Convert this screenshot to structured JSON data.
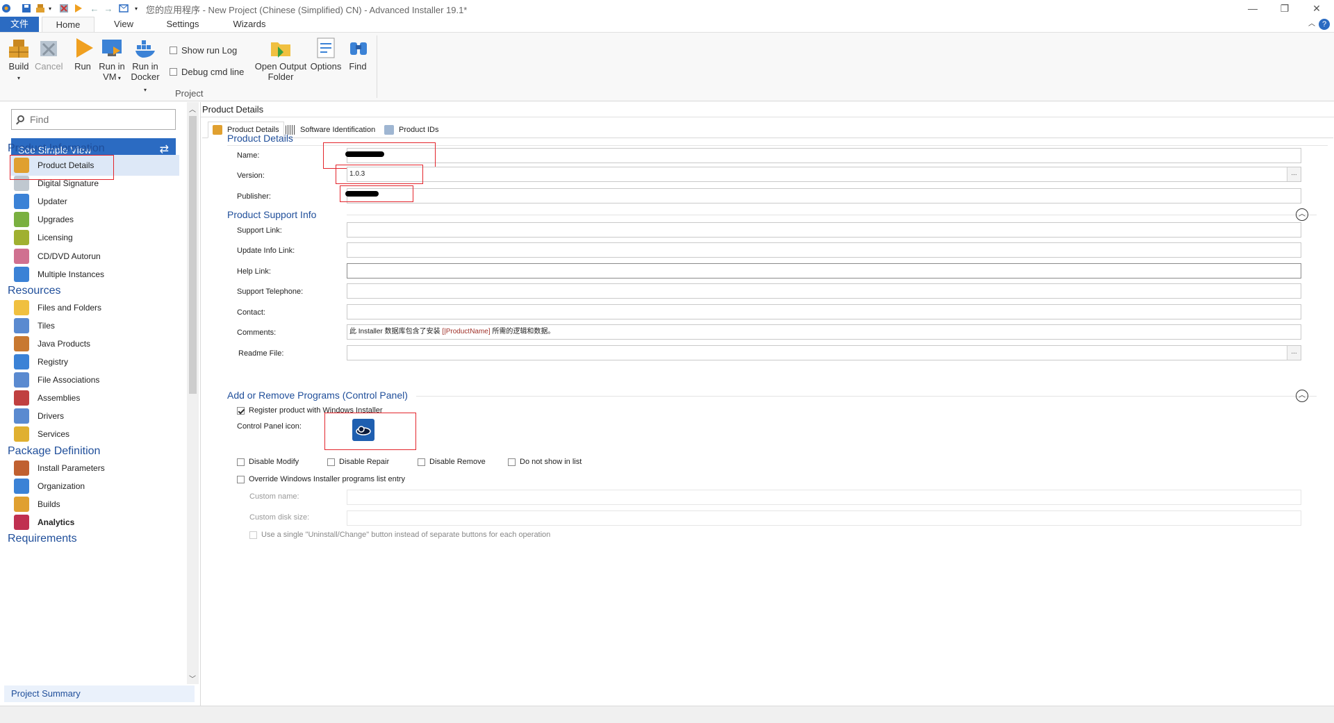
{
  "window": {
    "title": "您的应用程序 - New Project (Chinese (Simplified) CN) - Advanced Installer 19.1*"
  },
  "ribbon_tabs": [
    "文件",
    "Home",
    "View",
    "Settings",
    "Wizards"
  ],
  "ribbon": {
    "build": "Build",
    "cancel": "Cancel",
    "run": "Run",
    "run_vm": "Run in VM",
    "run_docker": "Run in Docker",
    "show_run_log": "Show run Log",
    "debug_cmd": "Debug cmd line",
    "open_output": "Open Output Folder",
    "options": "Options",
    "find": "Find",
    "group_label": "Project"
  },
  "left": {
    "find_placeholder": "Find",
    "simple_view": "See Simple View",
    "sections": [
      {
        "title": "Product Information",
        "items": [
          "Product Details",
          "Digital Signature",
          "Updater",
          "Upgrades",
          "Licensing",
          "CD/DVD Autorun",
          "Multiple Instances"
        ]
      },
      {
        "title": "Resources",
        "items": [
          "Files and Folders",
          "Tiles",
          "Java Products",
          "Registry",
          "File Associations",
          "Assemblies",
          "Drivers",
          "Services"
        ]
      },
      {
        "title": "Package Definition",
        "items": [
          "Install Parameters",
          "Organization",
          "Builds",
          "Analytics"
        ]
      },
      {
        "title": "Requirements",
        "items": []
      }
    ],
    "selected_item": "Product Details",
    "project_summary": "Project Summary"
  },
  "main": {
    "title": "Product Details",
    "tabs": [
      "Product Details",
      "Software Identification",
      "Product IDs"
    ],
    "product_details": {
      "heading": "Product Details",
      "name_label": "Name:",
      "version_label": "Version:",
      "version_value": "1.0.3",
      "publisher_label": "Publisher:"
    },
    "support": {
      "heading": "Product Support Info",
      "fields": [
        "Support Link:",
        "Update Info Link:",
        "Help Link:",
        "Support Telephone:",
        "Contact:",
        "Comments:",
        "Readme File:"
      ],
      "comments_pre": "此 Installer 数据库包含了安装 ",
      "comments_token": "[|ProductName]",
      "comments_post": " 所需的逻辑和数据。"
    },
    "arp": {
      "heading": "Add or Remove Programs (Control Panel)",
      "register": "Register product with Windows Installer",
      "register_checked": true,
      "icon_label": "Control Panel icon:",
      "disable_modify": "Disable Modify",
      "disable_repair": "Disable Repair",
      "disable_remove": "Disable Remove",
      "not_in_list": "Do not show in list",
      "override": "Override Windows Installer programs list entry",
      "custom_name": "Custom name:",
      "custom_disk": "Custom disk size:",
      "single_button": "Use a single \"Uninstall/Change\" button instead of separate buttons for each operation"
    }
  },
  "colors": {
    "accent": "#2b6bc2",
    "heading": "#1f4e9a",
    "annotation": "#e3242b"
  }
}
